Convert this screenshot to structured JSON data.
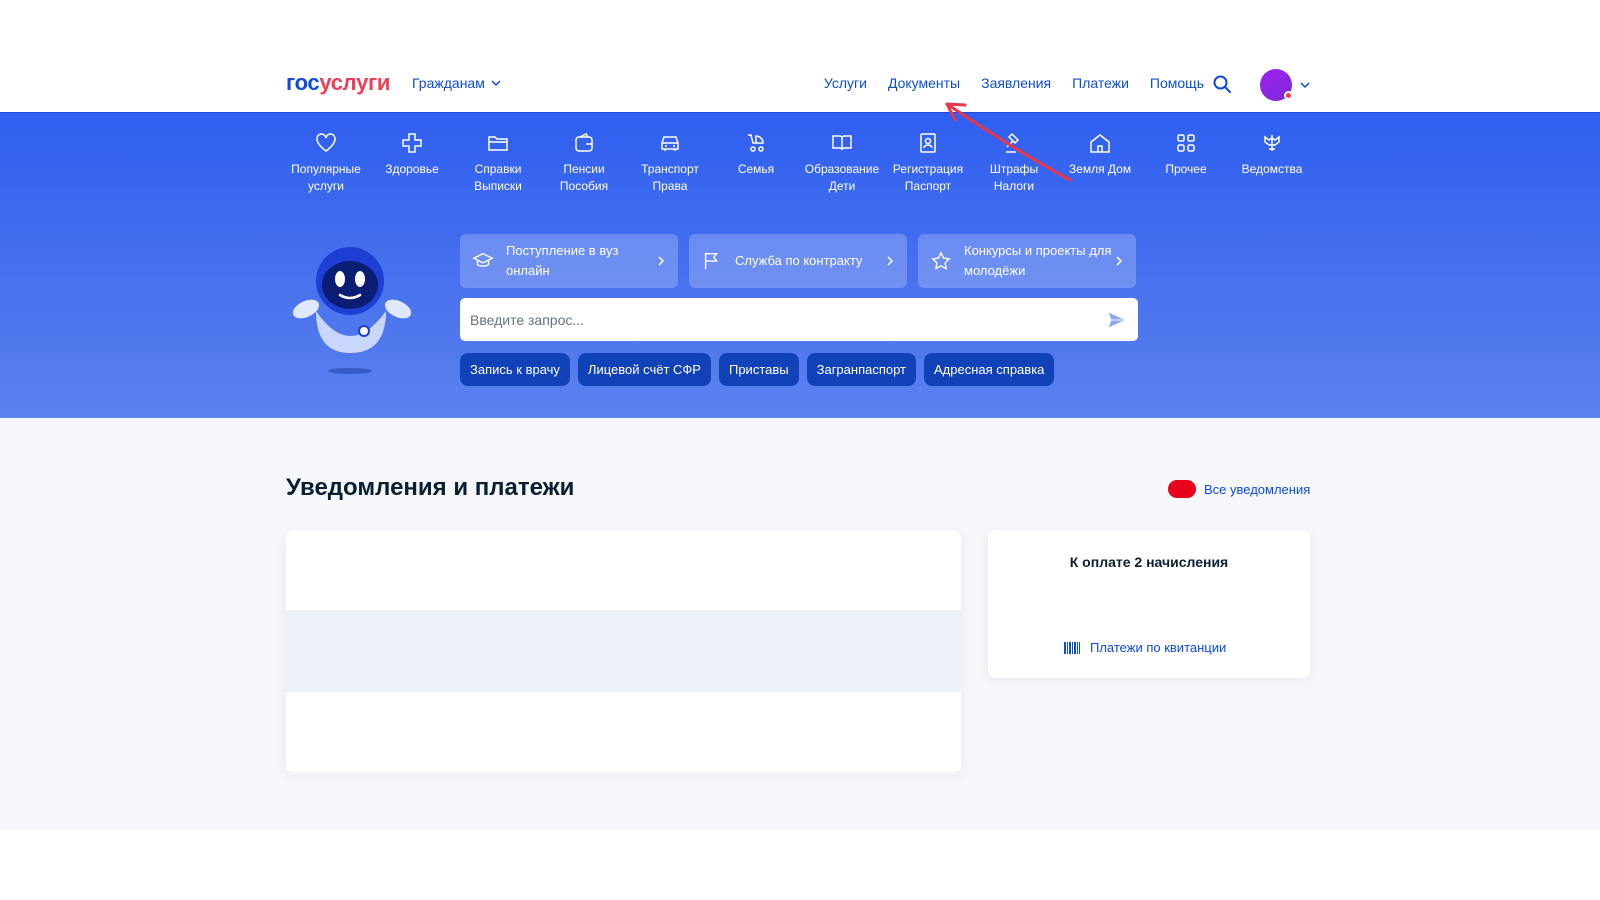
{
  "header": {
    "logo_part1": "гос",
    "logo_part2": "услуги",
    "role": "Гражданам",
    "nav": [
      "Услуги",
      "Документы",
      "Заявления",
      "Платежи",
      "Помощь"
    ]
  },
  "categories": [
    {
      "label": "Популярные\nуслуги",
      "icon": "heart-icon"
    },
    {
      "label": "Здоровье",
      "icon": "plus-cross-icon"
    },
    {
      "label": "Справки\nВыписки",
      "icon": "folder-icon"
    },
    {
      "label": "Пенсии\nПособия",
      "icon": "wallet-icon"
    },
    {
      "label": "Транспорт\nПрава",
      "icon": "car-icon"
    },
    {
      "label": "Семья",
      "icon": "stroller-icon"
    },
    {
      "label": "Образование\nДети",
      "icon": "book-icon"
    },
    {
      "label": "Регистрация\nПаспорт",
      "icon": "id-card-icon"
    },
    {
      "label": "Штрафы\nНалоги",
      "icon": "gavel-icon"
    },
    {
      "label": "Земля Дом",
      "icon": "house-icon"
    },
    {
      "label": "Прочее",
      "icon": "grid-icon"
    },
    {
      "label": "Ведомства",
      "icon": "emblem-icon"
    }
  ],
  "promos": [
    {
      "label": "Поступление в вуз онлайн",
      "icon": "graduation-cap-icon"
    },
    {
      "label": "Служба по контракту",
      "icon": "flag-icon"
    },
    {
      "label": "Конкурсы и проекты для молодёжи",
      "icon": "star-icon"
    }
  ],
  "search": {
    "placeholder": "Введите запрос..."
  },
  "chips": [
    "Запись к врачу",
    "Лицевой счёт СФР",
    "Приставы",
    "Загранпаспорт",
    "Адресная справка"
  ],
  "notifications": {
    "title": "Уведомления и платежи",
    "all_label": "Все уведомления"
  },
  "payments": {
    "title": "К оплате 2 начисления",
    "link": "Платежи по квитанции"
  },
  "colors": {
    "brand_blue": "#0d4cd3",
    "brand_red": "#ee3f58",
    "band_blue": "#2f5ff0",
    "chip_blue": "#1242b8",
    "toggle_red": "#e8001c",
    "annotation_red": "#e8364a"
  }
}
